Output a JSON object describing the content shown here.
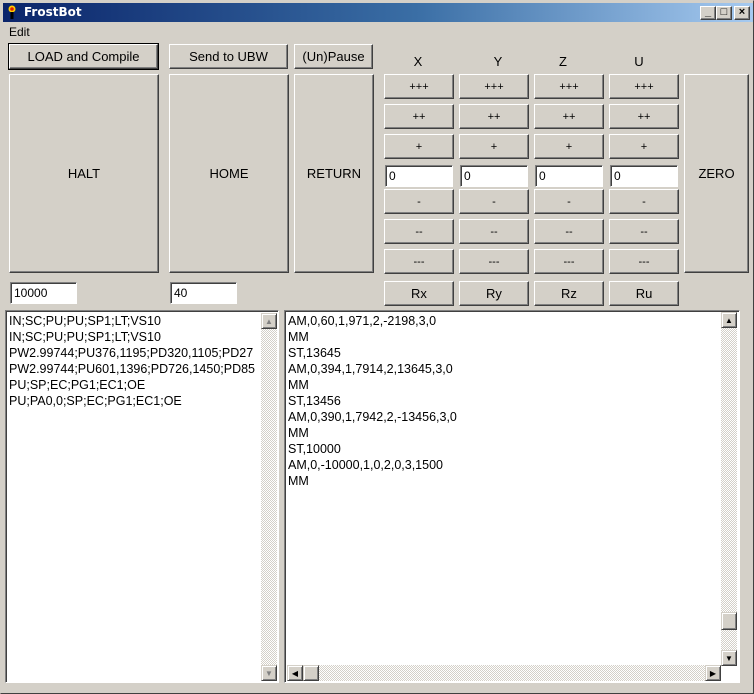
{
  "window": {
    "title": "FrostBot",
    "controls": {
      "minimize": "_",
      "maximize": "□",
      "close": "×"
    }
  },
  "menu": {
    "items": [
      "Edit"
    ]
  },
  "toolbar": {
    "load_compile": "LOAD and Compile",
    "send_ubw": "Send to UBW",
    "unpause": "(Un)Pause",
    "halt": "HALT",
    "home": "HOME",
    "return": "RETURN",
    "zero": "ZERO"
  },
  "fields": {
    "halt_value": "10000",
    "home_value": "40"
  },
  "axes": [
    {
      "label": "X",
      "inc3": "+++",
      "inc2": "++",
      "inc1": "+",
      "value": "0",
      "dec1": "-",
      "dec2": "--",
      "dec3": "---",
      "reset": "Rx"
    },
    {
      "label": "Y",
      "inc3": "+++",
      "inc2": "++",
      "inc1": "+",
      "value": "0",
      "dec1": "-",
      "dec2": "--",
      "dec3": "---",
      "reset": "Ry"
    },
    {
      "label": "Z",
      "inc3": "+++",
      "inc2": "++",
      "inc1": "+",
      "value": "0",
      "dec1": "-",
      "dec2": "--",
      "dec3": "---",
      "reset": "Rz"
    },
    {
      "label": "U",
      "inc3": "+++",
      "inc2": "++",
      "inc1": "+",
      "value": "0",
      "dec1": "-",
      "dec2": "--",
      "dec3": "---",
      "reset": "Ru"
    }
  ],
  "source_lines": [
    "IN;SC;PU;PU;SP1;LT;VS10",
    "IN;SC;PU;PU;SP1;LT;VS10",
    "PW2.99744;PU376,1195;PD320,1105;PD27",
    "PW2.99744;PU601,1396;PD726,1450;PD85",
    "PU;SP;EC;PG1;EC1;OE",
    "PU;PA0,0;SP;EC;PG1;EC1;OE"
  ],
  "output_lines": [
    "AM,0,60,1,971,2,-2198,3,0",
    "MM",
    "ST,13645",
    "AM,0,394,1,7914,2,13645,3,0",
    "MM",
    "ST,13456",
    "AM,0,390,1,7942,2,-13456,3,0",
    "MM",
    "ST,10000",
    "AM,0,-10000,1,0,2,0,3,1500",
    "MM"
  ]
}
